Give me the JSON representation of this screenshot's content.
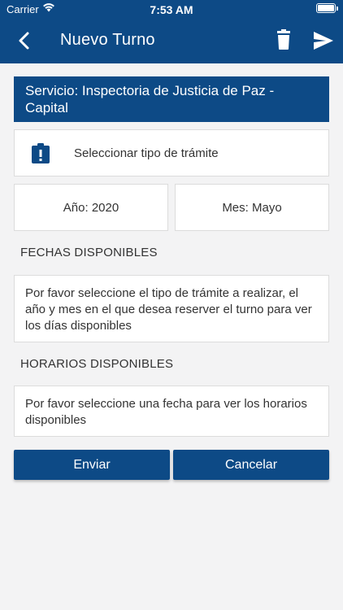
{
  "status_bar": {
    "carrier": "Carrier",
    "time": "7:53 AM"
  },
  "header": {
    "title": "Nuevo Turno",
    "icons": [
      "back-chevron-icon",
      "trash-icon",
      "send-icon"
    ],
    "color": "#0d4a86"
  },
  "service": {
    "label": "Servicio: Inspectoria de Justicia de Paz - Capital"
  },
  "tramite": {
    "icon": "clipboard-alert-icon",
    "label": "Seleccionar tipo de trámite"
  },
  "date_selectors": {
    "anio": "Año: 2020",
    "mes": "Mes: Mayo"
  },
  "fechas": {
    "title": "FECHAS DISPONIBLES",
    "message": "Por favor seleccione el tipo de trámite a realizar, el año y mes en el que desea reserver el turno para ver los días disponibles"
  },
  "horarios": {
    "title": "HORARIOS DISPONIBLES",
    "message": "Por favor seleccione una fecha para ver los horarios disponibles"
  },
  "actions": {
    "enviar": "Enviar",
    "cancelar": "Cancelar"
  }
}
